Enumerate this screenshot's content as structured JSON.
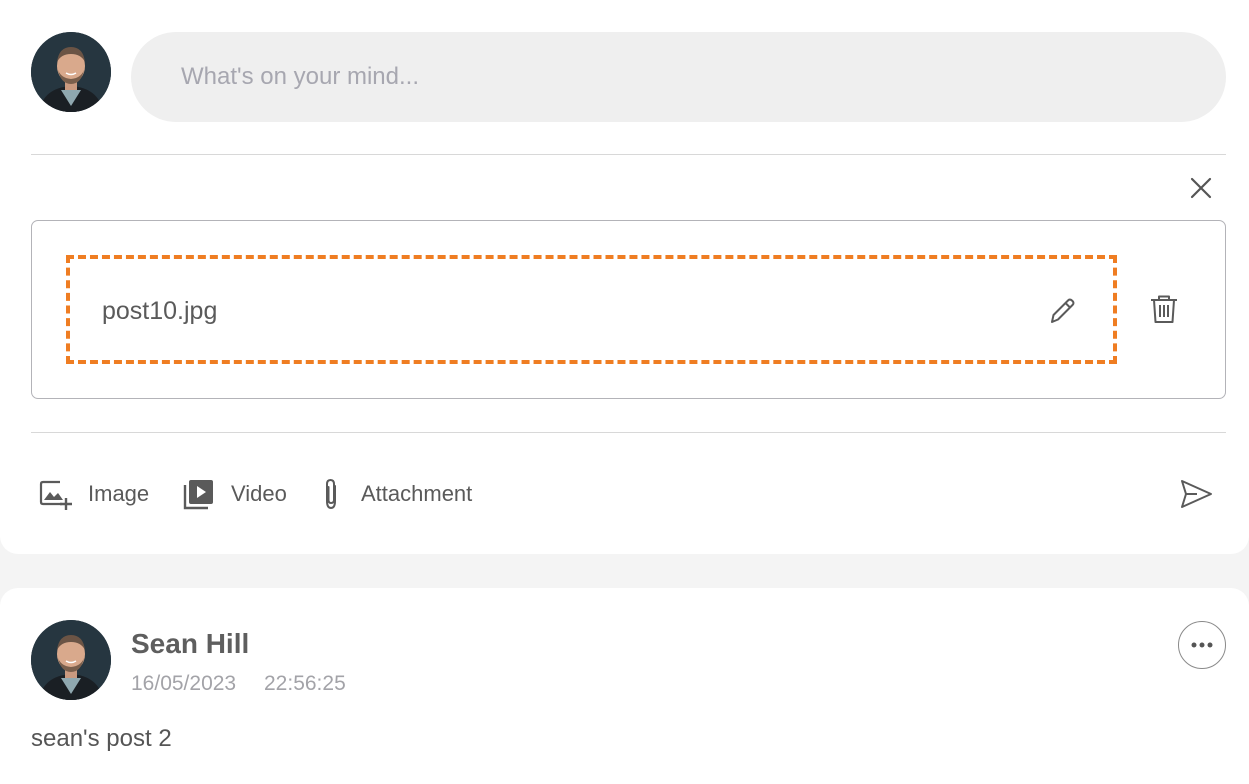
{
  "composer": {
    "placeholder": "What's on your mind...",
    "attachment": {
      "file_name": "post10.jpg"
    },
    "accent_color": "#ef7d22",
    "toolbar": {
      "image_label": "Image",
      "video_label": "Video",
      "attachment_label": "Attachment"
    },
    "icons": {
      "close": "close-icon",
      "edit": "pencil-icon",
      "delete": "trash-icon",
      "image": "image-add-icon",
      "video": "video-library-icon",
      "attachment": "paperclip-icon",
      "send": "send-icon"
    }
  },
  "post": {
    "author": "Sean Hill",
    "date": "16/05/2023",
    "time": "22:56:25",
    "body": "sean's post 2",
    "icons": {
      "more": "more-horizontal-icon"
    }
  }
}
